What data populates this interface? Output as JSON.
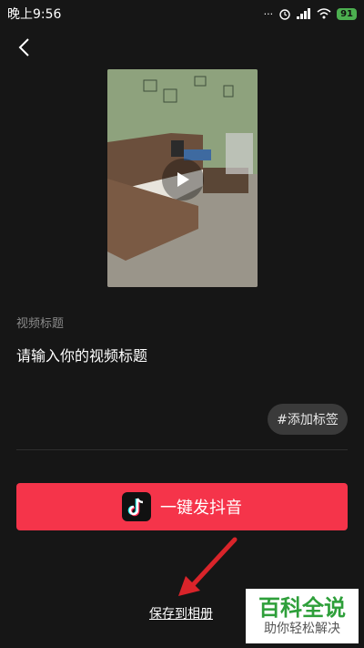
{
  "status_bar": {
    "time": "晚上9:56",
    "battery": "91"
  },
  "form": {
    "title_label": "视频标题",
    "title_placeholder": "请输入你的视频标题",
    "add_tag_label": "#添加标签"
  },
  "actions": {
    "publish_label": "一键发抖音",
    "save_label": "保存到相册"
  },
  "watermark": {
    "main": "百科全说",
    "sub": "助你轻松解决"
  },
  "colors": {
    "background": "#161616",
    "accent": "#f5344a",
    "tag_bg": "#3a3a3a"
  },
  "icons": [
    "back-arrow-icon",
    "play-icon",
    "douyin-logo-icon",
    "signal-icon",
    "wifi-icon",
    "alarm-icon"
  ]
}
